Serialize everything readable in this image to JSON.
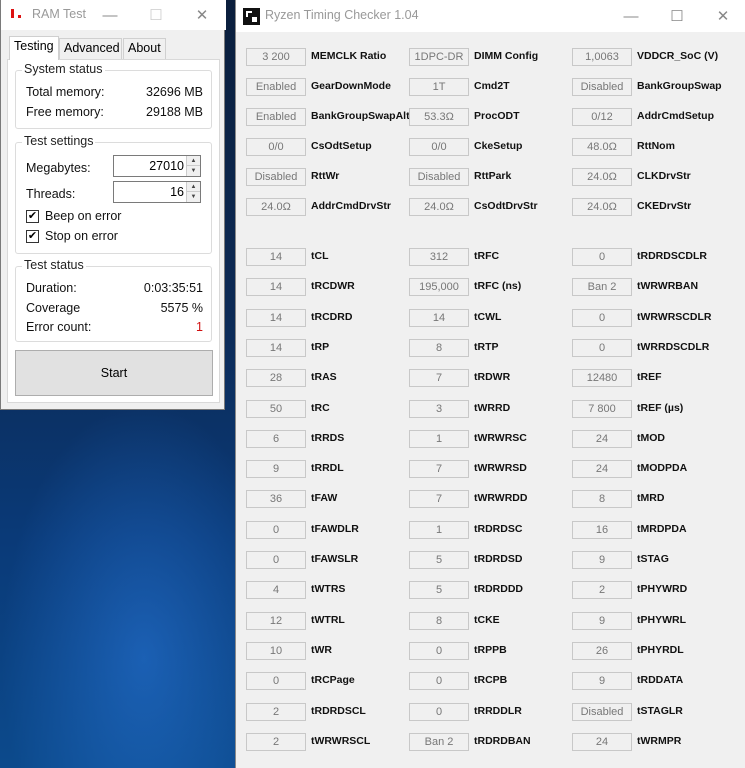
{
  "ram_test": {
    "title": "RAM Test",
    "titlebar": {
      "minimize": "—",
      "maximize": "☐",
      "close": "✕"
    },
    "tabs": [
      "Testing",
      "Advanced",
      "About"
    ],
    "active_tab": "Testing",
    "system_status": {
      "title": "System status",
      "total_label": "Total memory:",
      "total_value": "32696 MB",
      "free_label": "Free memory:",
      "free_value": "29188 MB"
    },
    "test_settings": {
      "title": "Test settings",
      "megabytes_label": "Megabytes:",
      "megabytes_value": "27010",
      "threads_label": "Threads:",
      "threads_value": "16",
      "beep_label": "Beep on error",
      "beep_checked": true,
      "stop_label": "Stop on error",
      "stop_checked": true
    },
    "test_status": {
      "title": "Test status",
      "duration_label": "Duration:",
      "duration_value": "0:03:35:51",
      "coverage_label": "Coverage",
      "coverage_value": "5575 %",
      "error_label": "Error count:",
      "error_value": "1"
    },
    "start_label": "Start",
    "colors": {
      "error": "#d01010",
      "logo": "#dd1111"
    }
  },
  "ryzen_timing_checker": {
    "title": "Ryzen Timing Checker 1.04",
    "titlebar": {
      "minimize": "—",
      "maximize": "☐",
      "close": "✕"
    },
    "rows": [
      [
        {
          "value": "3 200",
          "name": "MEMCLK Ratio"
        },
        {
          "value": "1DPC-DR",
          "name": "DIMM Config"
        },
        {
          "value": "1,0063",
          "name": "VDDCR_SoC (V)"
        }
      ],
      [
        {
          "value": "Enabled",
          "name": "GearDownMode"
        },
        {
          "value": "1T",
          "name": "Cmd2T"
        },
        {
          "value": "Disabled",
          "name": "BankGroupSwap"
        }
      ],
      [
        {
          "value": "Enabled",
          "name": "BankGroupSwapAlt"
        },
        {
          "value": "53.3Ω",
          "name": "ProcODT"
        },
        {
          "value": "0/12",
          "name": "AddrCmdSetup"
        }
      ],
      [
        {
          "value": "0/0",
          "name": "CsOdtSetup"
        },
        {
          "value": "0/0",
          "name": "CkeSetup"
        },
        {
          "value": "48.0Ω",
          "name": "RttNom"
        }
      ],
      [
        {
          "value": "Disabled",
          "name": "RttWr"
        },
        {
          "value": "Disabled",
          "name": "RttPark"
        },
        {
          "value": "24.0Ω",
          "name": "CLKDrvStr"
        }
      ],
      [
        {
          "value": "24.0Ω",
          "name": "AddrCmdDrvStr"
        },
        {
          "value": "24.0Ω",
          "name": "CsOdtDrvStr"
        },
        {
          "value": "24.0Ω",
          "name": "CKEDrvStr"
        }
      ],
      [
        {
          "value": "14",
          "name": "tCL"
        },
        {
          "value": "312",
          "name": "tRFC"
        },
        {
          "value": "0",
          "name": "tRDRDSCDLR"
        }
      ],
      [
        {
          "value": "14",
          "name": "tRCDWR"
        },
        {
          "value": "195,000",
          "name": "tRFC (ns)"
        },
        {
          "value": "Ban 2",
          "name": "tWRWRBAN"
        }
      ],
      [
        {
          "value": "14",
          "name": "tRCDRD"
        },
        {
          "value": "14",
          "name": "tCWL"
        },
        {
          "value": "0",
          "name": "tWRWRSCDLR"
        }
      ],
      [
        {
          "value": "14",
          "name": "tRP"
        },
        {
          "value": "8",
          "name": "tRTP"
        },
        {
          "value": "0",
          "name": "tWRRDSCDLR"
        }
      ],
      [
        {
          "value": "28",
          "name": "tRAS"
        },
        {
          "value": "7",
          "name": "tRDWR"
        },
        {
          "value": "12480",
          "name": "tREF"
        }
      ],
      [
        {
          "value": "50",
          "name": "tRC"
        },
        {
          "value": "3",
          "name": "tWRRD"
        },
        {
          "value": "7 800",
          "name": "tREF (µs)"
        }
      ],
      [
        {
          "value": "6",
          "name": "tRRDS"
        },
        {
          "value": "1",
          "name": "tWRWRSC"
        },
        {
          "value": "24",
          "name": "tMOD"
        }
      ],
      [
        {
          "value": "9",
          "name": "tRRDL"
        },
        {
          "value": "7",
          "name": "tWRWRSD"
        },
        {
          "value": "24",
          "name": "tMODPDA"
        }
      ],
      [
        {
          "value": "36",
          "name": "tFAW"
        },
        {
          "value": "7",
          "name": "tWRWRDD"
        },
        {
          "value": "8",
          "name": "tMRD"
        }
      ],
      [
        {
          "value": "0",
          "name": "tFAWDLR"
        },
        {
          "value": "1",
          "name": "tRDRDSC"
        },
        {
          "value": "16",
          "name": "tMRDPDA"
        }
      ],
      [
        {
          "value": "0",
          "name": "tFAWSLR"
        },
        {
          "value": "5",
          "name": "tRDRDSD"
        },
        {
          "value": "9",
          "name": "tSTAG"
        }
      ],
      [
        {
          "value": "4",
          "name": "tWTRS"
        },
        {
          "value": "5",
          "name": "tRDRDDD"
        },
        {
          "value": "2",
          "name": "tPHYWRD"
        }
      ],
      [
        {
          "value": "12",
          "name": "tWTRL"
        },
        {
          "value": "8",
          "name": "tCKE"
        },
        {
          "value": "9",
          "name": "tPHYWRL"
        }
      ],
      [
        {
          "value": "10",
          "name": "tWR"
        },
        {
          "value": "0",
          "name": "tRPPB"
        },
        {
          "value": "26",
          "name": "tPHYRDL"
        }
      ],
      [
        {
          "value": "0",
          "name": "tRCPage"
        },
        {
          "value": "0",
          "name": "tRCPB"
        },
        {
          "value": "9",
          "name": "tRDDATA"
        }
      ],
      [
        {
          "value": "2",
          "name": "tRDRDSCL"
        },
        {
          "value": "0",
          "name": "tRRDDLR"
        },
        {
          "value": "Disabled",
          "name": "tSTAGLR"
        }
      ],
      [
        {
          "value": "2",
          "name": "tWRWRSCL"
        },
        {
          "value": "Ban 2",
          "name": "tRDRDBAN"
        },
        {
          "value": "24",
          "name": "tWRMPR"
        }
      ]
    ]
  }
}
